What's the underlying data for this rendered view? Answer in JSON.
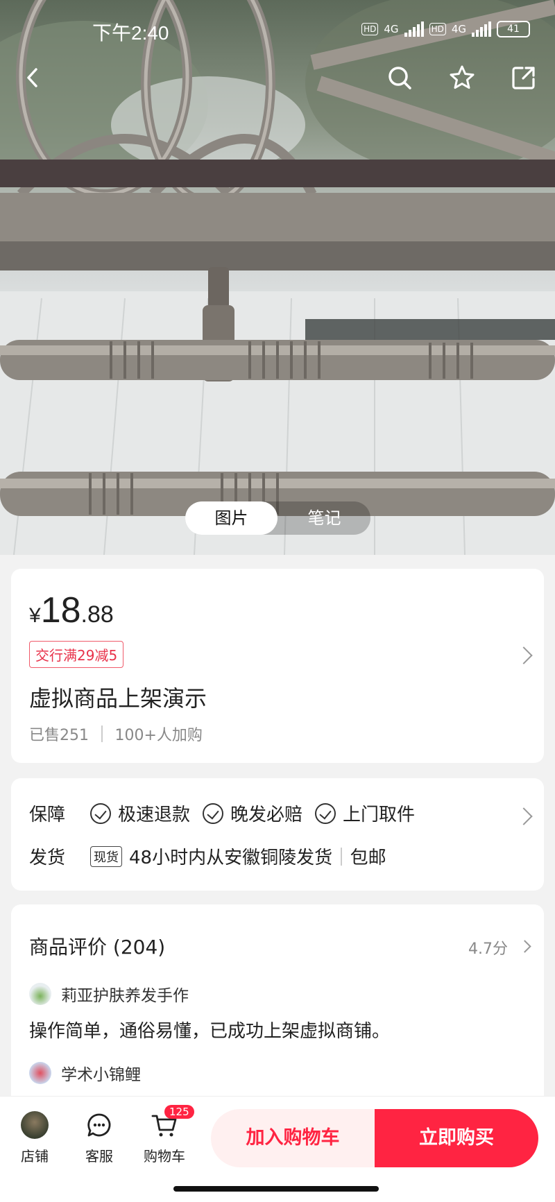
{
  "status_bar": {
    "time": "下午2:40",
    "net1": "4G",
    "net2": "4G",
    "hd": "HD",
    "battery": "41"
  },
  "top_actions": {
    "back": "back-icon",
    "search": "search-icon",
    "favorite": "star-icon",
    "share": "share-icon"
  },
  "media_tabs": [
    {
      "label": "图片",
      "active": true
    },
    {
      "label": "笔记",
      "active": false
    }
  ],
  "product": {
    "currency": "¥",
    "price_int": "18",
    "price_dec": ".88",
    "promo": "交行满29减5",
    "title": "虚拟商品上架演示",
    "sold": "已售251",
    "added": "100+人加购"
  },
  "service": {
    "guarantee_label": "保障",
    "guarantees": [
      "极速退款",
      "晚发必赔",
      "上门取件"
    ],
    "shipping_label": "发货",
    "stock_tag": "现货",
    "shipping_text": "48小时内从安徽铜陵发货",
    "free_shipping": "包邮"
  },
  "reviews": {
    "title": "商品评价 (204)",
    "score": "4.7分",
    "items": [
      {
        "user": "莉亚护肤养发手作",
        "text": "操作简单，通俗易懂，已成功上架虚拟商铺。"
      },
      {
        "user": "学术小锦鲤",
        "text": ""
      }
    ]
  },
  "bottom_bar": {
    "shop": "店铺",
    "service": "客服",
    "cart": "购物车",
    "cart_count": "125",
    "add_to_cart": "加入购物车",
    "buy_now": "立即购买"
  },
  "colors": {
    "accent": "#ff2442",
    "promo": "#e8324a",
    "muted": "#888888"
  }
}
